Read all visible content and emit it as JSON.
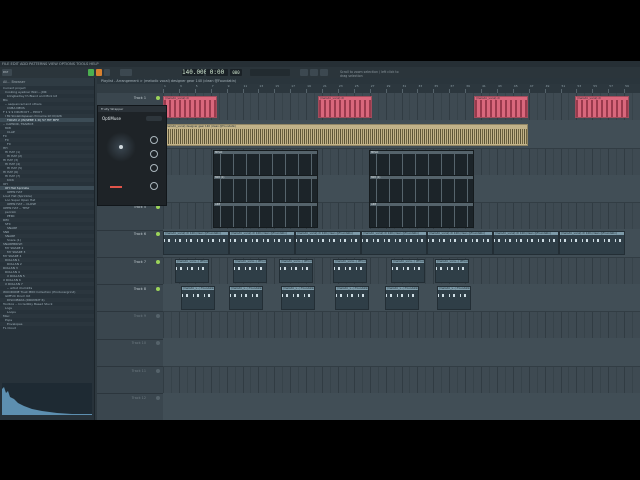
{
  "menu": {
    "text": "FILE EDIT ADD PATTERNS VIEW OPTIONS TOOLS HELP"
  },
  "toolbar": {
    "pattern_label": "PAT",
    "time_display": "0:00",
    "time_sub": "000",
    "tempo": "140.000",
    "hint_text": "Scroll to zoom selection / left click to drag selection",
    "colors": {
      "play": "#4caf50",
      "record": "#d9812f"
    }
  },
  "browser": {
    "header": "All... Browser",
    "items": [
      {
        "label": "Current project",
        "selected": false
      },
      {
        "label": "Cooking eyeliner Wiki -- JNK",
        "selected": false
      },
      {
        "label": "blingbadlay th Blend and Mick kit",
        "selected": false
      },
      {
        "label": "Blo",
        "selected": false
      },
      {
        "label": "-- sequenced and others",
        "selected": false
      },
      {
        "label": "CUBA NEOS",
        "selected": false
      },
      {
        "label": "F 1 9 9 DRUM KIT -- EP.KIT",
        "selected": false
      },
      {
        "label": "I Mr.Skolelidspesel chrneme kit III/426",
        "selected": false
      },
      {
        "label": "TODAY 2 (W/SEBE 1 D) 57 HIT MFP",
        "selected": true
      },
      {
        "label": "-- CAPNOR, TRAMO3",
        "selected": false
      },
      {
        "label": "808",
        "selected": false
      },
      {
        "label": "CLAP",
        "selected": false
      },
      {
        "label": "FX",
        "selected": false
      },
      {
        "label": "FX",
        "selected": false
      },
      {
        "label": "FX",
        "selected": false
      },
      {
        "label": "HH",
        "selected": false
      },
      {
        "label": "HI HAT (1)",
        "selected": false
      },
      {
        "label": "HI HAT (2)",
        "selected": false
      },
      {
        "label": "HI HAT (3)",
        "selected": false
      },
      {
        "label": "HI HAT (4)",
        "selected": false
      },
      {
        "label": "HI HAT (5)",
        "selected": false
      },
      {
        "label": "HI HAT (6)",
        "selected": false
      },
      {
        "label": "HI HAT (7)",
        "selected": false
      },
      {
        "label": "KICK",
        "selected": false
      },
      {
        "label": "OH",
        "selected": false
      },
      {
        "label": "OH Hat Sprinkle",
        "selected": true
      },
      {
        "label": "OPEN HAT",
        "selected": false
      },
      {
        "label": "Loud Hat (Sprinkle)",
        "selected": false
      },
      {
        "label": "Loo Super Open Hat",
        "selected": false
      },
      {
        "label": "OPEN HAT -- CLOSE",
        "selected": false
      },
      {
        "label": "OPEN HAT -- TEST",
        "selected": false
      },
      {
        "label": "perclok",
        "selected": false
      },
      {
        "label": "PERC",
        "selected": false
      },
      {
        "label": "RIM",
        "selected": false
      },
      {
        "label": "SFX",
        "selected": false
      },
      {
        "label": "SNARE",
        "selected": false
      },
      {
        "label": "SNR",
        "selected": false
      },
      {
        "label": "SNARE",
        "selected": false
      },
      {
        "label": "Snare (1)",
        "selected": false
      },
      {
        "label": "SNAREBRISH",
        "selected": false
      },
      {
        "label": "MY SNARE 2",
        "selected": false
      },
      {
        "label": "MY SNARE 3",
        "selected": false
      },
      {
        "label": "MY SNARE 4",
        "selected": false
      },
      {
        "label": "ROLLSN 1",
        "selected": false
      },
      {
        "label": "ROLLSN 2",
        "selected": false
      },
      {
        "label": "ROLLSN 3",
        "selected": false
      },
      {
        "label": "ROLLSN 4",
        "selected": false
      },
      {
        "label": "X ROLLSN 5",
        "selected": false
      },
      {
        "label": "X ROLLSN 6",
        "selected": false
      },
      {
        "label": "X ROLLSN 7",
        "selected": false
      },
      {
        "label": "-- artist drumkits",
        "selected": false
      },
      {
        "label": "WOODONE Trust MIDI Collection (Producergrind)",
        "selected": false
      },
      {
        "label": "GMFUC Drum Kit",
        "selected": false
      },
      {
        "label": "DISCOBRAS (DRUMKIT 6)",
        "selected": false
      },
      {
        "label": "Toolbox -- Incredibly Based Stuck",
        "selected": false
      },
      {
        "label": "Logs",
        "selected": false
      },
      {
        "label": "Loops",
        "selected": false
      },
      {
        "label": "Misc",
        "selected": false
      },
      {
        "label": "Pops",
        "selected": false
      },
      {
        "label": "Envelopes",
        "selected": false
      },
      {
        "label": "FL Cloud",
        "selected": false
      }
    ]
  },
  "playlist": {
    "title": "Playlist - Arrangement > (melodic vocal) designer gear 140 (clean @Foundatin)",
    "bars": [
      "1",
      "3",
      "5",
      "7",
      "9",
      "11",
      "13",
      "15",
      "17",
      "19",
      "21",
      "23",
      "25",
      "27",
      "29",
      "31",
      "33",
      "35",
      "37",
      "39",
      "41",
      "43",
      "45",
      "47",
      "49",
      "51",
      "53",
      "55",
      "57",
      "59"
    ],
    "tracks": [
      {
        "label": "Track 1",
        "active": true
      },
      {
        "label": "Track 2",
        "active": true
      },
      {
        "label": "Track 3",
        "active": true
      },
      {
        "label": "Track 4",
        "active": true
      },
      {
        "label": "Track 5",
        "active": true
      },
      {
        "label": "Track 6",
        "active": true
      },
      {
        "label": "Track 7",
        "active": true
      },
      {
        "label": "Track 8",
        "active": true
      },
      {
        "label": "Track 9",
        "active": false
      },
      {
        "label": "Track 10",
        "active": false
      },
      {
        "label": "Track 11",
        "active": false
      },
      {
        "label": "Track 12",
        "active": false
      }
    ],
    "clip_names": {
      "drums": "(melodic_vocal) dr",
      "vocal": "(melodic_vocal) designer gear 140 (clean @Foundatin)",
      "ptn_a": "MELO",
      "ptn_b": "808 (1)",
      "ptn_c": "ARP",
      "ptn_d": "(melodic_vocal) dr 140 (clean @Foundatin)",
      "ptn_e": "(melodic_voca...) #Foundatn",
      "ptn_f": "(melodic_v...) Foundatin"
    }
  },
  "plugin": {
    "title": "Fruity Wrapper",
    "brand": "OptiMuse"
  }
}
